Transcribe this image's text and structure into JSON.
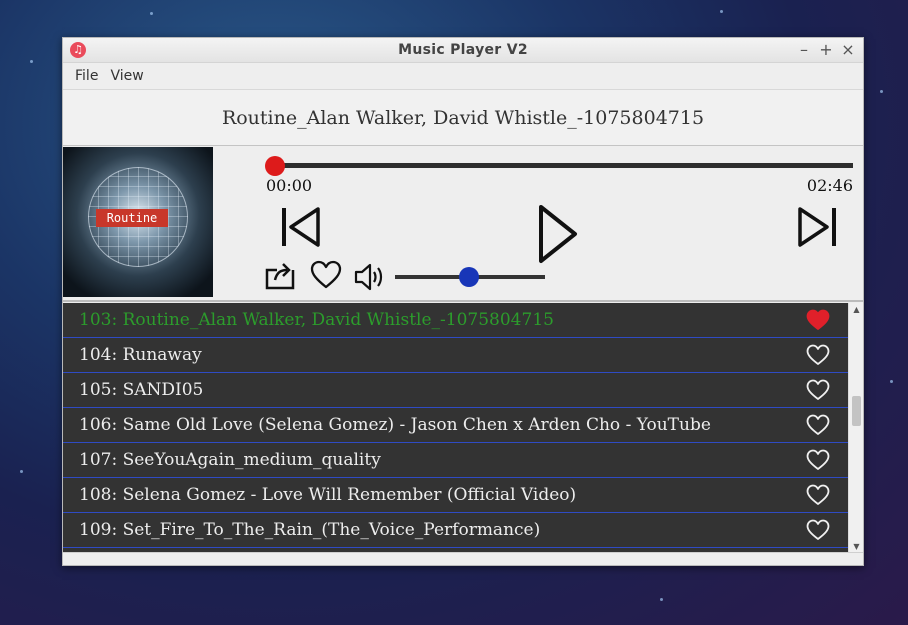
{
  "window": {
    "title": "Music Player V2",
    "app_icon": "music-note-icon",
    "controls": [
      "minimize-icon",
      "maximize-icon",
      "close-icon"
    ]
  },
  "menu": {
    "file": "File",
    "view": "View"
  },
  "now_playing": {
    "title": "Routine_Alan Walker, David Whistle_-1075804715"
  },
  "album_art": {
    "text": "Routine"
  },
  "player": {
    "current_time": "00:00",
    "total_time": "02:46",
    "progress_fraction": 0.0,
    "volume_fraction": 0.5,
    "colors": {
      "progress_knob": "#dd1b1b",
      "volume_knob": "#1836b8",
      "active_track": "#2c9c2c",
      "favorite": "#e0202a"
    }
  },
  "playlist": {
    "items": [
      {
        "label": "103: Routine_Alan Walker, David Whistle_-1075804715",
        "favorite": true,
        "active": true
      },
      {
        "label": "104: Runaway",
        "favorite": false,
        "active": false
      },
      {
        "label": "105: SANDI05",
        "favorite": false,
        "active": false
      },
      {
        "label": "106: Same Old Love (Selena Gomez) - Jason Chen x Arden Cho - YouTube",
        "favorite": false,
        "active": false
      },
      {
        "label": "107: SeeYouAgain_medium_quality",
        "favorite": false,
        "active": false
      },
      {
        "label": "108: Selena Gomez - Love Will Remember (Official Video)",
        "favorite": false,
        "active": false
      },
      {
        "label": "109: Set_Fire_To_The_Rain_(The_Voice_Performance)",
        "favorite": false,
        "active": false
      }
    ]
  }
}
